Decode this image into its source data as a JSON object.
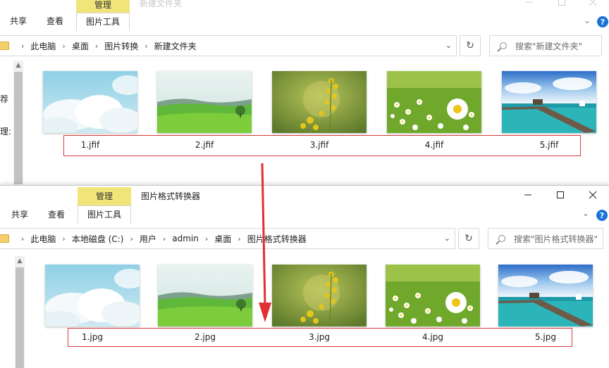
{
  "colors": {
    "context_tab_header": "#f1e57a",
    "highlight_box": "#d93a3a",
    "arrow": "#e03030",
    "help_icon": "#1a73d8"
  },
  "top_window": {
    "ribbon": {
      "tab_share": "共享",
      "tab_view": "查看",
      "context_header": "管理",
      "context_tab": "图片工具"
    },
    "title": "新建文件夹",
    "address": {
      "crumbs": [
        "此电脑",
        "桌面",
        "图片转换",
        "新建文件夹"
      ]
    },
    "search_placeholder": "搜索\"新建文件夹\"",
    "nav_fragments": [
      "荐",
      "理:"
    ],
    "files": [
      {
        "name": "1.jfif",
        "thumb": "sky-clouds"
      },
      {
        "name": "2.jfif",
        "thumb": "green-field"
      },
      {
        "name": "3.jfif",
        "thumb": "rapeseed-flowers"
      },
      {
        "name": "4.jfif",
        "thumb": "daisies"
      },
      {
        "name": "5.jfif",
        "thumb": "sea-pier"
      }
    ]
  },
  "bottom_window": {
    "ribbon": {
      "tab_share": "共享",
      "tab_view": "查看",
      "context_header": "管理",
      "context_tab": "图片工具"
    },
    "title": "图片格式转换器",
    "address": {
      "crumbs": [
        "此电脑",
        "本地磁盘 (C:)",
        "用户",
        "admin",
        "桌面",
        "图片格式转换器"
      ]
    },
    "search_placeholder": "搜索\"图片格式转换器\"",
    "files": [
      {
        "name": "1.jpg",
        "thumb": "sky-clouds"
      },
      {
        "name": "2.jpg",
        "thumb": "green-field"
      },
      {
        "name": "3.jpg",
        "thumb": "rapeseed-flowers"
      },
      {
        "name": "4.jpg",
        "thumb": "daisies"
      },
      {
        "name": "5.jpg",
        "thumb": "sea-pier"
      }
    ]
  },
  "icons": {
    "minimize": "minimize-icon",
    "maximize": "maximize-icon",
    "close": "close-icon",
    "help": "help-icon",
    "refresh": "refresh-icon",
    "search": "search-icon",
    "folder": "folder-icon",
    "dropdown": "chevron-down-icon",
    "ribbon_expand": "chevron-down-icon"
  }
}
